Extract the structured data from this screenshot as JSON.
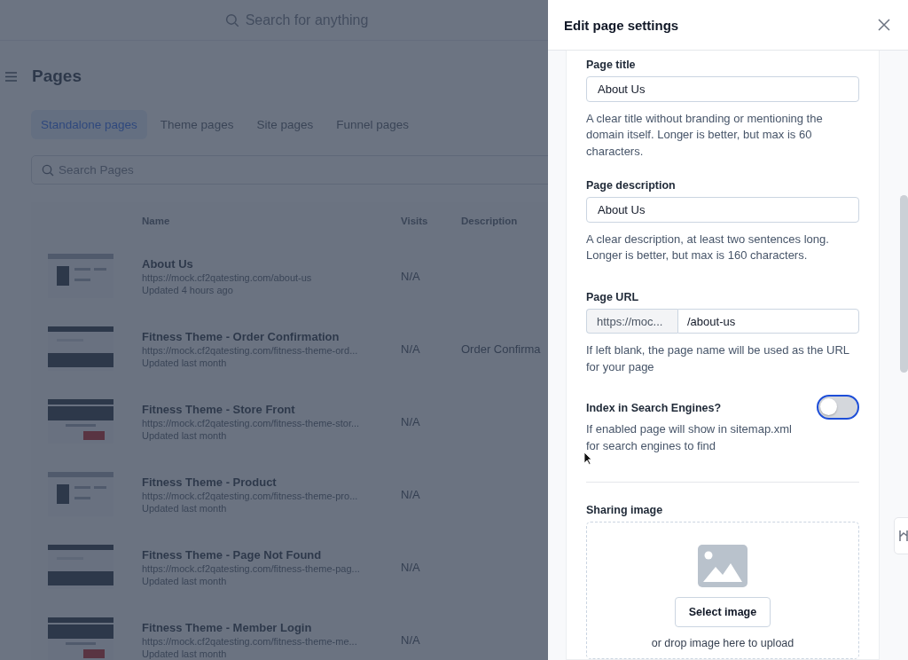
{
  "top_bar": {
    "search_placeholder": "Search for anything"
  },
  "page": {
    "title": "Pages",
    "tabs": [
      {
        "label": "Standalone pages",
        "selected": true
      },
      {
        "label": "Theme pages",
        "selected": false
      },
      {
        "label": "Site pages",
        "selected": false
      },
      {
        "label": "Funnel pages",
        "selected": false
      }
    ],
    "search": {
      "placeholder": "Search Pages"
    },
    "table": {
      "columns": [
        "Name",
        "Visits",
        "Description"
      ],
      "rows": [
        {
          "name": "About Us",
          "url": "https://mock.cf2qatesting.com/about-us",
          "updated": "Updated 4 hours ago",
          "visits": "N/A"
        },
        {
          "name": "Fitness Theme - Order Confirmation",
          "url": "https://mock.cf2qatesting.com/fitness-theme-ord...",
          "updated": "Updated last month",
          "visits": "N/A",
          "description": "Order Confirma"
        },
        {
          "name": "Fitness Theme - Store Front",
          "url": "https://mock.cf2qatesting.com/fitness-theme-stor...",
          "updated": "Updated last month",
          "visits": "N/A"
        },
        {
          "name": "Fitness Theme - Product",
          "url": "https://mock.cf2qatesting.com/fitness-theme-pro...",
          "updated": "Updated last month",
          "visits": "N/A"
        },
        {
          "name": "Fitness Theme - Page Not Found",
          "url": "https://mock.cf2qatesting.com/fitness-theme-pag...",
          "updated": "Updated last month",
          "visits": "N/A"
        },
        {
          "name": "Fitness Theme - Member Login",
          "url": "https://mock.cf2qatesting.com/fitness-theme-me...",
          "updated": "Updated last month",
          "visits": "N/A"
        }
      ]
    }
  },
  "drawer": {
    "title": "Edit page settings",
    "page_title": {
      "label": "Page title",
      "value": "About Us",
      "help": "A clear title without branding or mentioning the domain itself. Longer is better, but max is 60 characters."
    },
    "page_description": {
      "label": "Page description",
      "value": "About Us",
      "help": "A clear description, at least two sentences long. Longer is better, but max is 160 characters."
    },
    "page_url": {
      "label": "Page URL",
      "prefix": "https://moc...",
      "value": "/about-us",
      "help": "If left blank, the page name will be used as the URL for your page"
    },
    "index": {
      "label": "Index in Search Engines?",
      "help": "If enabled page will show in sitemap.xml for search engines to find",
      "on": false
    },
    "sharing_image": {
      "label": "Sharing image",
      "button": "Select image",
      "hint": "or drop image here to upload"
    }
  }
}
